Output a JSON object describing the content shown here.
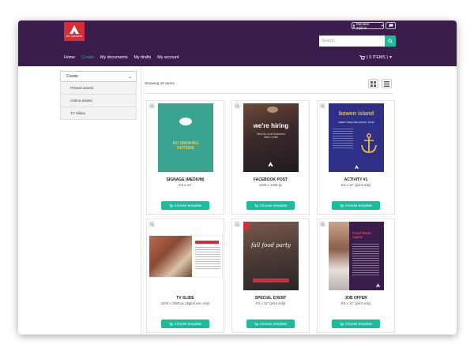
{
  "header": {
    "logo_text": "AV CANADA",
    "member_label": "Member Zipline",
    "search_placeholder": "Search...",
    "nav": [
      "Home",
      "Create",
      "My documents",
      "My drafts",
      "My account"
    ],
    "active_nav": "Create",
    "cart_label": "( 0 ITEMS )"
  },
  "sidebar": {
    "heading": "Create",
    "items": [
      "Printed assets",
      "Online assets",
      "TV slides"
    ]
  },
  "main": {
    "showing": "Showing 10 items",
    "cards": [
      {
        "title": "SIGNAGE (MEDIUM)",
        "size": "8.5 x 11\"",
        "button": "Choose template",
        "thumb": {
          "logo": "",
          "headline": "NO SMOKING OUTSIDE"
        }
      },
      {
        "title": "FACEBOOK POST",
        "size": "1200 x 1200 px",
        "button": "Choose template",
        "thumb": {
          "headline": "we're hiring",
          "sub": "Work for us at Downtown Sales Centre"
        }
      },
      {
        "title": "ACTIVITY #1",
        "size": "8.5 x 11\" (print only)",
        "button": "Choose template",
        "thumb": {
          "headline": "bowen island",
          "sub": "FERRY RIDE AND HIKING TOUR"
        }
      },
      {
        "title": "TV SLIDE",
        "size": "1920 x 1080 px (digital use only)",
        "button": "Choose template",
        "thumb": {}
      },
      {
        "title": "SPECIAL EVENT",
        "size": "8.5 x 11\" (print only)",
        "button": "Choose template",
        "thumb": {
          "headline": "fall food party"
        }
      },
      {
        "title": "JOB OFFER",
        "size": "8.5 x 11\" (print only)",
        "button": "Choose template",
        "thumb": {
          "headline": "Front Desk Agent"
        }
      }
    ]
  },
  "colors": {
    "header_bg": "#3a1d4d",
    "accent": "#1abc9c",
    "brand_red": "#d32f3a"
  },
  "icons": [
    "user-icon",
    "chat-icon",
    "search-icon",
    "cart-icon",
    "chevron-down-icon",
    "grid-view-icon",
    "list-view-icon",
    "zoom-icon"
  ]
}
